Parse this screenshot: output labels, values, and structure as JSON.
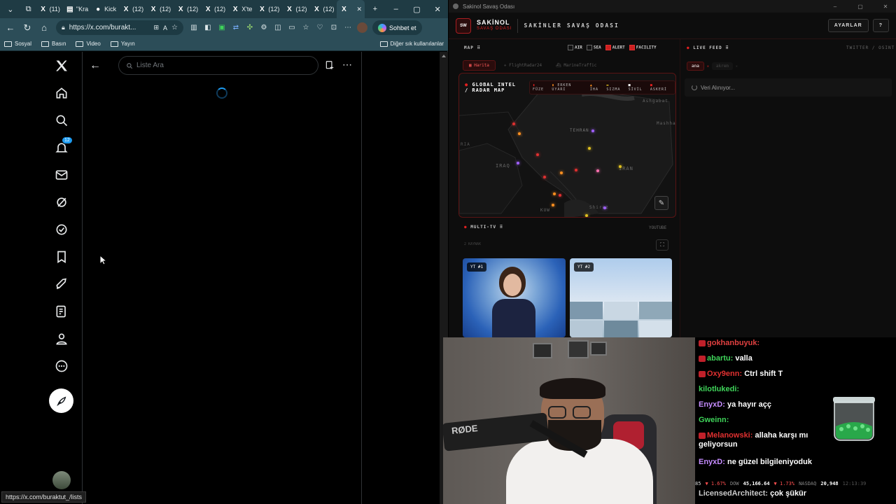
{
  "browser": {
    "tabs": [
      {
        "icon": "X",
        "label": "(11)"
      },
      {
        "icon": "▤",
        "label": "\"Kra"
      },
      {
        "icon": "●",
        "label": "Kick"
      },
      {
        "icon": "X",
        "label": "(12)"
      },
      {
        "icon": "X",
        "label": "(12)"
      },
      {
        "icon": "X",
        "label": "(12)"
      },
      {
        "icon": "X",
        "label": "(12)"
      },
      {
        "icon": "X",
        "label": "X'te"
      },
      {
        "icon": "X",
        "label": "(12)"
      },
      {
        "icon": "X",
        "label": "(12)"
      },
      {
        "icon": "X",
        "label": "(12)"
      },
      {
        "icon": "X",
        "label": ""
      }
    ],
    "url": "https://x.com/burakt...",
    "copilot_label": "Sohbet et",
    "bookmarks": [
      "Sosyal",
      "Basın",
      "Video",
      "Yayın"
    ],
    "other_bookmarks": "Diğer sık kullanılanlar",
    "status_url": "https://x.com/buraktut_/lists"
  },
  "x": {
    "search_placeholder": "Liste Ara",
    "notification_count": "12",
    "nav_icons": [
      "home-icon",
      "search-icon",
      "notifications-icon",
      "messages-icon",
      "grok-icon",
      "verified-icon",
      "bookmarks-icon",
      "rocket-icon",
      "lists-icon",
      "profile-icon",
      "more-icon"
    ]
  },
  "sakinol": {
    "window_title": "Sakinol Savaş Odası",
    "brand": "SAKİNOL",
    "brand_sub": "SAVAŞ ODASI",
    "header_title": "SAKİNLER SAVAŞ ODASI",
    "settings_label": "AYARLAR",
    "help_label": "?",
    "map_section": "MAP",
    "filters": [
      {
        "label": "AIR",
        "checked": false
      },
      {
        "label": "SEA",
        "checked": false
      },
      {
        "label": "ALERT",
        "checked": true
      },
      {
        "label": "FACILITY",
        "checked": true
      }
    ],
    "map_tabs": [
      "Harita",
      "FlightRadar24",
      "MarineTraffic"
    ],
    "map_title_1": "GLOBAL INTEL",
    "map_title_2": "/ RADAR MAP",
    "legend": [
      "FÜZE",
      "ERKEN UYARI",
      "İHA",
      "SIZMA",
      "SİVİL",
      "ASKERİ"
    ],
    "map_places": [
      "Ashgabat",
      "Mashha",
      "TEHRAN",
      "IRAQ",
      "IRAN",
      "KUW",
      "Shiraz",
      "RIA"
    ],
    "multitv_label": "MULTI-TV",
    "multitv_source": "YOUTUBE",
    "multitv_count": "2 KAYNAK",
    "videos": [
      "YT #1",
      "YT #2"
    ],
    "live_feed_label": "LIVE FEED",
    "live_feed_source": "TWITTER / OSINT",
    "feed_tabs": [
      "ana",
      "akrem"
    ],
    "loading_text": "Veri Alınıyor..."
  },
  "chat": {
    "messages": [
      {
        "user": "gokhanbuyuk:",
        "text": "",
        "color": "#e04040",
        "badge": true
      },
      {
        "user": "abartu:",
        "text": "valla",
        "color": "#3fd45a",
        "badge": true
      },
      {
        "user": "Oxy9enn:",
        "text": "Ctrl shift T",
        "color": "#e03030",
        "badge": true
      },
      {
        "user": "kilotlukedi:",
        "text": "",
        "color": "#3fd45a",
        "badge": false
      },
      {
        "user": "EnyxD:",
        "text": "ya hayır açç",
        "color": "#c58cff",
        "badge": false
      },
      {
        "user": "Gweinn:",
        "text": "",
        "color": "#3fd45a",
        "badge": false
      },
      {
        "user": "Melanowski:",
        "text": "allaha karşı mı geliyorsun",
        "color": "#e03030",
        "badge": true
      },
      {
        "user": "EnyxD:",
        "text": "ne güzel bilgileniyoduk",
        "color": "#c58cff",
        "badge": false
      },
      {
        "user": "LicensedArchitect:",
        "text": "çok şükür",
        "color": "#cccccc",
        "badge": false
      }
    ],
    "ticker": [
      {
        "label": "85",
        "change": "▼ 1.67%",
        "value": ""
      },
      {
        "label": "DOW",
        "change": "",
        "value": "45,166.64"
      },
      {
        "label": "",
        "change": "▼ 1.73%",
        "value": ""
      },
      {
        "label": "NASDAQ",
        "change": "",
        "value": "20,948"
      }
    ],
    "clock": "12:13:39"
  },
  "colors": {
    "tab_bar": "#1f3b44",
    "x_blue": "#1d9bf0",
    "sakinol_red": "#e02020"
  }
}
